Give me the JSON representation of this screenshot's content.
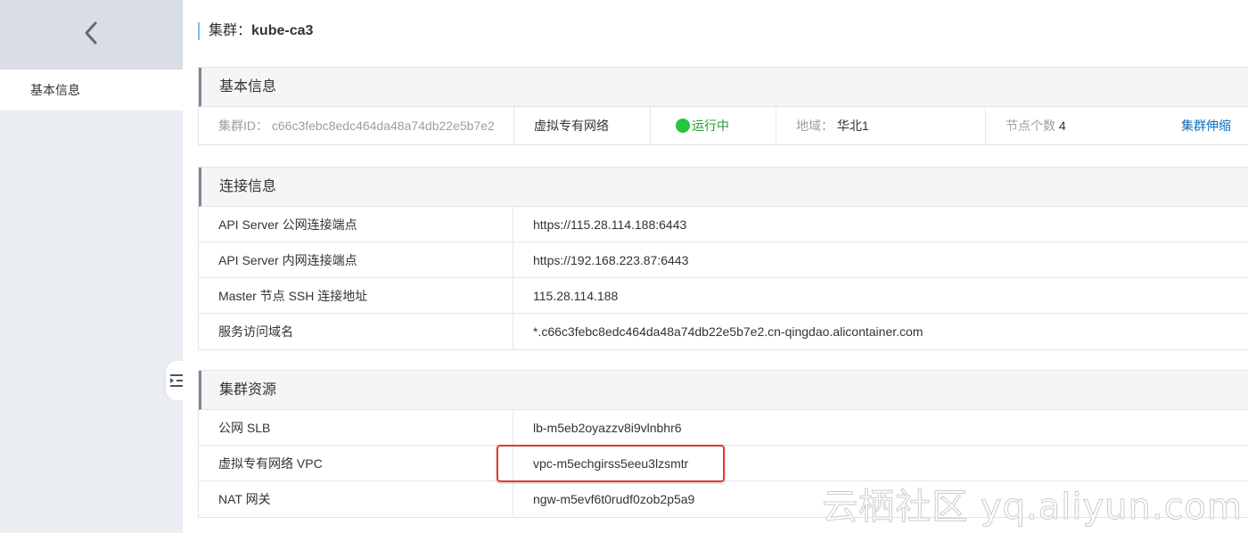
{
  "sidebar": {
    "nav_label": "基本信息"
  },
  "page": {
    "title_prefix": "集群：",
    "title_name": "kube-ca3"
  },
  "basic_info": {
    "header": "基本信息",
    "cluster_id_label": "集群ID：",
    "cluster_id": "c66c3febc8edc464da48a74db22e5b7e2",
    "network_type": "虚拟专有网络",
    "status": "运行中",
    "region_label": "地域：",
    "region": "华北1",
    "node_count_label": "节点个数",
    "node_count": "4",
    "scale_link": "集群伸缩"
  },
  "connection_info": {
    "header": "连接信息",
    "rows": [
      {
        "key": "API Server 公网连接端点",
        "value": "https://115.28.114.188:6443"
      },
      {
        "key": "API Server 内网连接端点",
        "value": "https://192.168.223.87:6443"
      },
      {
        "key": "Master 节点 SSH 连接地址",
        "value": "115.28.114.188"
      },
      {
        "key": "服务访问域名",
        "value": "*.c66c3febc8edc464da48a74db22e5b7e2.cn-qingdao.alicontainer.com"
      }
    ]
  },
  "cluster_resources": {
    "header": "集群资源",
    "rows": [
      {
        "key": "公网 SLB",
        "value": "lb-m5eb2oyazzv8i9vlnbhr6"
      },
      {
        "key": "虚拟专有网络 VPC",
        "value": "vpc-m5echgirss5eeu3lzsmtr"
      },
      {
        "key": "NAT 网关",
        "value": "ngw-m5evf6t0rudf0zob2p5a9"
      }
    ]
  },
  "watermark": "云栖社区 yq.aliyun.com",
  "colors": {
    "link": "#0e6fc1",
    "status_green": "#25c73c",
    "highlight_red": "#e23b30"
  }
}
